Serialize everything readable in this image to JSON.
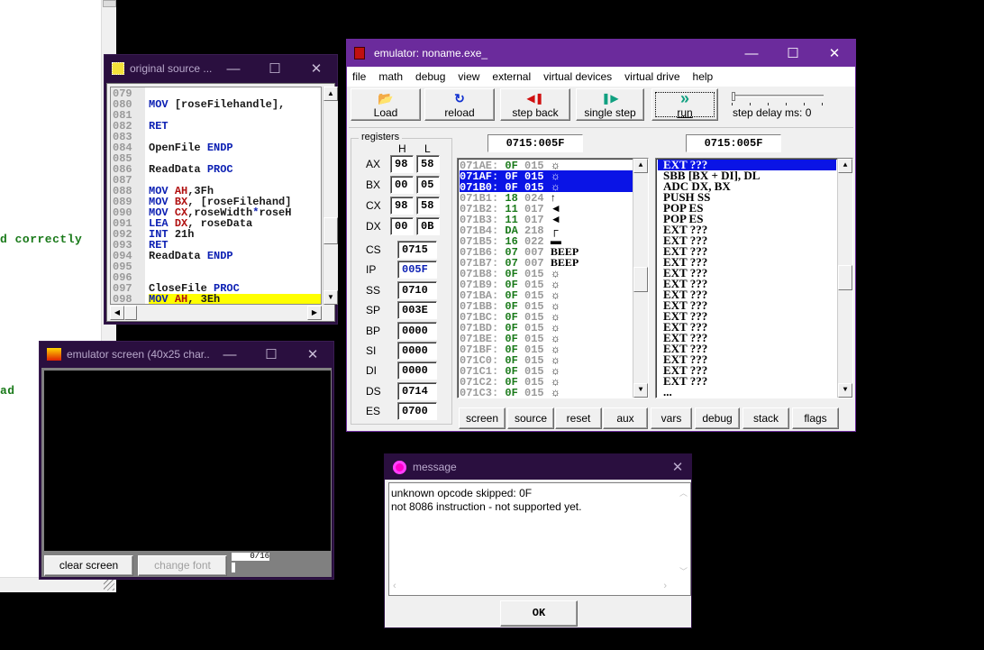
{
  "background_editor": {
    "lines": [
      "d correctly",
      "ad"
    ]
  },
  "source_window": {
    "title": "original source ...",
    "minimize": "—",
    "maximize": "☐",
    "close": "✕",
    "lines": [
      {
        "n": "079",
        "code": ""
      },
      {
        "n": "080",
        "code": "MOV [roseFilehandle],"
      },
      {
        "n": "081",
        "code": ""
      },
      {
        "n": "082",
        "code": "RET"
      },
      {
        "n": "083",
        "code": ""
      },
      {
        "n": "084",
        "code": "OpenFile ENDP"
      },
      {
        "n": "085",
        "code": ""
      },
      {
        "n": "086",
        "code": "ReadData PROC"
      },
      {
        "n": "087",
        "code": ""
      },
      {
        "n": "088",
        "code": "MOV AH,3Fh"
      },
      {
        "n": "089",
        "code": "MOV BX, [roseFilehand]"
      },
      {
        "n": "090",
        "code": "MOV CX,roseWidth*roseH"
      },
      {
        "n": "091",
        "code": "LEA DX, roseData"
      },
      {
        "n": "092",
        "code": "INT 21h"
      },
      {
        "n": "093",
        "code": "RET"
      },
      {
        "n": "094",
        "code": "ReadData ENDP"
      },
      {
        "n": "095",
        "code": ""
      },
      {
        "n": "096",
        "code": ""
      },
      {
        "n": "097",
        "code": "CloseFile PROC"
      },
      {
        "n": "098",
        "code": "MOV AH, 3Eh",
        "highlight": true
      }
    ]
  },
  "screen_window": {
    "title": "emulator screen (40x25 char...",
    "minimize": "—",
    "maximize": "☐",
    "close": "✕",
    "clear_screen": "clear screen",
    "change_font": "change font",
    "counter": "0/16"
  },
  "emulator": {
    "title": "emulator: noname.exe_",
    "minimize": "—",
    "maximize": "☐",
    "close": "✕",
    "menu": [
      "file",
      "math",
      "debug",
      "view",
      "external",
      "virtual devices",
      "virtual drive",
      "help"
    ],
    "toolbar": [
      {
        "label": "Load",
        "icon": "📂",
        "icon_name": "folder-open-icon",
        "color": "#c8a000"
      },
      {
        "label": "reload",
        "icon": "↻",
        "icon_name": "reload-icon",
        "color": "#1030d0"
      },
      {
        "label": "step back",
        "icon": "◀❚",
        "icon_name": "step-back-icon",
        "color": "#d01010"
      },
      {
        "label": "single step",
        "icon": "❚▶",
        "icon_name": "single-step-icon",
        "color": "#10a080"
      },
      {
        "label": "run",
        "icon": "»",
        "icon_name": "run-icon",
        "color": "#10a080"
      }
    ],
    "step_delay_label": "step delay ms: 0",
    "step_delay_value": 0,
    "registers": {
      "title": "registers",
      "h": "H",
      "l": "L",
      "pairs": [
        {
          "name": "AX",
          "h": "98",
          "l": "58"
        },
        {
          "name": "BX",
          "h": "00",
          "l": "05"
        },
        {
          "name": "CX",
          "h": "98",
          "l": "58"
        },
        {
          "name": "DX",
          "h": "00",
          "l": "0B"
        }
      ],
      "singles": [
        {
          "name": "CS",
          "value": "0715"
        },
        {
          "name": "IP",
          "value": "005F",
          "highlight": true
        },
        {
          "name": "SS",
          "value": "0710"
        },
        {
          "name": "SP",
          "value": "003E"
        },
        {
          "name": "BP",
          "value": "0000"
        },
        {
          "name": "SI",
          "value": "0000"
        },
        {
          "name": "DI",
          "value": "0000"
        },
        {
          "name": "DS",
          "value": "0714"
        },
        {
          "name": "ES",
          "value": "0700"
        }
      ]
    },
    "memory_address": "0715:005F",
    "disasm_address": "0715:005F",
    "memory": [
      {
        "addr": "071AE:",
        "hex": "0F",
        "dec": "015",
        "ch": "☼"
      },
      {
        "addr": "071AF:",
        "hex": "0F",
        "dec": "015",
        "ch": "☼",
        "sel": true
      },
      {
        "addr": "071B0:",
        "hex": "0F",
        "dec": "015",
        "ch": "☼",
        "sel": true
      },
      {
        "addr": "071B1:",
        "hex": "18",
        "dec": "024",
        "ch": "↑"
      },
      {
        "addr": "071B2:",
        "hex": "11",
        "dec": "017",
        "ch": "◄"
      },
      {
        "addr": "071B3:",
        "hex": "11",
        "dec": "017",
        "ch": "◄"
      },
      {
        "addr": "071B4:",
        "hex": "DA",
        "dec": "218",
        "ch": "┌"
      },
      {
        "addr": "071B5:",
        "hex": "16",
        "dec": "022",
        "ch": "▬"
      },
      {
        "addr": "071B6:",
        "hex": "07",
        "dec": "007",
        "ch": "BEEP"
      },
      {
        "addr": "071B7:",
        "hex": "07",
        "dec": "007",
        "ch": "BEEP"
      },
      {
        "addr": "071B8:",
        "hex": "0F",
        "dec": "015",
        "ch": "☼"
      },
      {
        "addr": "071B9:",
        "hex": "0F",
        "dec": "015",
        "ch": "☼"
      },
      {
        "addr": "071BA:",
        "hex": "0F",
        "dec": "015",
        "ch": "☼"
      },
      {
        "addr": "071BB:",
        "hex": "0F",
        "dec": "015",
        "ch": "☼"
      },
      {
        "addr": "071BC:",
        "hex": "0F",
        "dec": "015",
        "ch": "☼"
      },
      {
        "addr": "071BD:",
        "hex": "0F",
        "dec": "015",
        "ch": "☼"
      },
      {
        "addr": "071BE:",
        "hex": "0F",
        "dec": "015",
        "ch": "☼"
      },
      {
        "addr": "071BF:",
        "hex": "0F",
        "dec": "015",
        "ch": "☼"
      },
      {
        "addr": "071C0:",
        "hex": "0F",
        "dec": "015",
        "ch": "☼"
      },
      {
        "addr": "071C1:",
        "hex": "0F",
        "dec": "015",
        "ch": "☼"
      },
      {
        "addr": "071C2:",
        "hex": "0F",
        "dec": "015",
        "ch": "☼"
      },
      {
        "addr": "071C3:",
        "hex": "0F",
        "dec": "015",
        "ch": "☼"
      }
    ],
    "disasm": [
      {
        "text": "EXT ???",
        "sel": true
      },
      {
        "text": "SBB [BX + DI], DL"
      },
      {
        "text": "ADC DX, BX"
      },
      {
        "text": "PUSH SS"
      },
      {
        "text": "POP ES"
      },
      {
        "text": "POP ES"
      },
      {
        "text": "EXT ???"
      },
      {
        "text": "EXT ???"
      },
      {
        "text": "EXT ???"
      },
      {
        "text": "EXT ???"
      },
      {
        "text": "EXT ???"
      },
      {
        "text": "EXT ???"
      },
      {
        "text": "EXT ???"
      },
      {
        "text": "EXT ???"
      },
      {
        "text": "EXT ???"
      },
      {
        "text": "EXT ???"
      },
      {
        "text": "EXT ???"
      },
      {
        "text": "EXT ???"
      },
      {
        "text": "EXT ???"
      },
      {
        "text": "EXT ???"
      },
      {
        "text": "EXT ???"
      },
      {
        "text": "..."
      }
    ],
    "bottom_buttons": [
      "screen",
      "source",
      "reset",
      "aux",
      "vars",
      "debug",
      "stack",
      "flags"
    ]
  },
  "message": {
    "title": "message",
    "close": "✕",
    "lines": [
      "unknown opcode skipped: 0F",
      "not 8086 instruction - not supported yet."
    ],
    "ok": "OK"
  }
}
